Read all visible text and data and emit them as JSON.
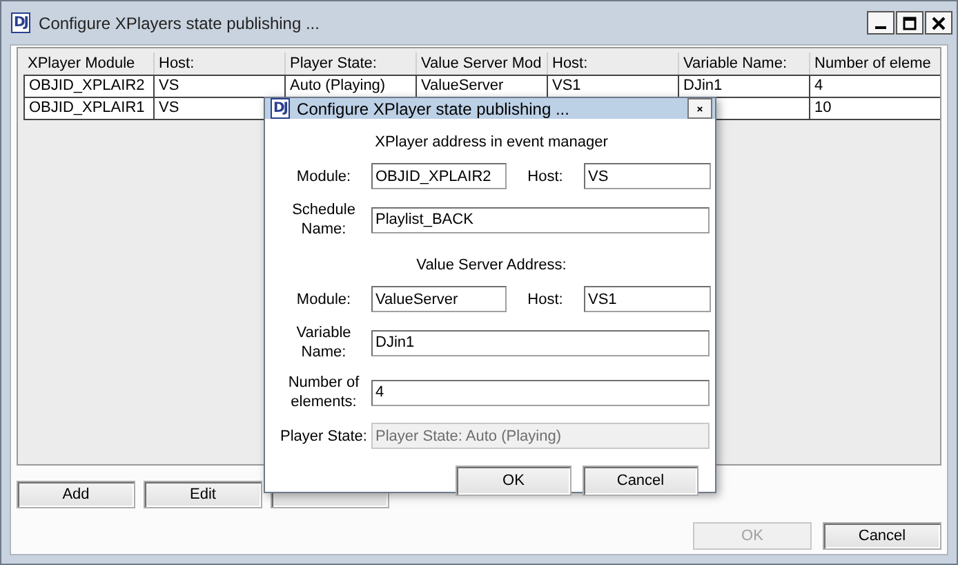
{
  "window": {
    "logo": "DJ",
    "title": "Configure XPlayers state publishing ..."
  },
  "table": {
    "columns": [
      "XPlayer Module",
      "Host:",
      "Player State:",
      "Value Server Mod",
      "Host:",
      "Variable Name:",
      "Number of eleme"
    ],
    "rows": [
      {
        "cells": [
          "OBJID_XPLAIR2",
          "VS",
          "Auto (Playing)",
          "ValueServer",
          "VS1",
          "DJin1",
          "4"
        ]
      },
      {
        "cells": [
          "OBJID_XPLAIR1",
          "VS",
          null,
          null,
          null,
          null,
          "10"
        ]
      }
    ]
  },
  "list_buttons": [
    {
      "kind": "button",
      "label": "Add",
      "disabled": false
    },
    {
      "kind": "button",
      "label": "Edit",
      "disabled": false
    },
    {
      "kind": "covered"
    }
  ],
  "buttons": [
    {
      "label": "OK",
      "disabled": true
    },
    {
      "label": "Cancel",
      "disabled": false
    }
  ],
  "dialog": {
    "logo": "DJ",
    "title": "Configure XPlayer state publishing ...",
    "sections": [
      {
        "heading": "XPlayer address in event manager",
        "rows": [
          {
            "kind": "pair",
            "fields": [
              {
                "label": "Module:",
                "value": "OBJID_XPLAIR2"
              },
              {
                "label": "Host:",
                "value": "VS"
              }
            ]
          },
          {
            "kind": "single",
            "label": "Schedule Name:",
            "value": "Playlist_BACK"
          }
        ]
      },
      {
        "heading": "Value Server Address:",
        "rows": [
          {
            "kind": "pair",
            "fields": [
              {
                "label": "Module:",
                "value": "ValueServer"
              },
              {
                "label": "Host:",
                "value": "VS1"
              }
            ]
          },
          {
            "kind": "single",
            "label": "Variable Name:",
            "value": "DJin1"
          },
          {
            "kind": "single",
            "label": "Number of elements:",
            "value": "4"
          },
          {
            "kind": "single",
            "label": "Player State:",
            "value": "Player State: Auto (Playing)",
            "disabled": true
          }
        ]
      }
    ],
    "buttons": [
      {
        "label": "OK",
        "disabled": false
      },
      {
        "label": "Cancel",
        "disabled": false
      }
    ]
  }
}
